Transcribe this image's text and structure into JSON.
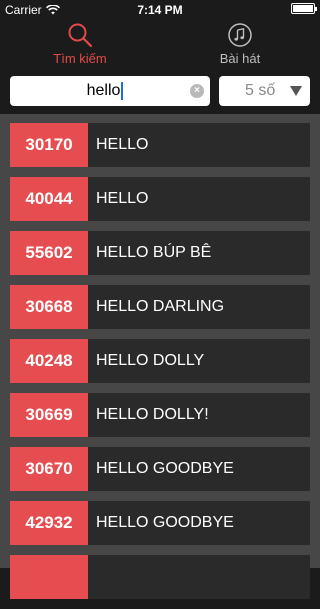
{
  "status": {
    "carrier": "Carrier",
    "time": "7:14 PM"
  },
  "tabs": [
    {
      "label": "Tìm kiếm",
      "icon": "search-icon",
      "active": true
    },
    {
      "label": "Bài hát",
      "icon": "music-note-icon",
      "active": false
    }
  ],
  "search": {
    "value": "hello"
  },
  "filter": {
    "selected": "5 số"
  },
  "results": [
    {
      "code": "30170",
      "title": "HELLO"
    },
    {
      "code": "40044",
      "title": "HELLO"
    },
    {
      "code": "55602",
      "title": "HELLO BÚP BÊ"
    },
    {
      "code": "30668",
      "title": "HELLO DARLING"
    },
    {
      "code": "40248",
      "title": "HELLO DOLLY"
    },
    {
      "code": "30669",
      "title": "HELLO DOLLY!"
    },
    {
      "code": "30670",
      "title": "HELLO GOODBYE"
    },
    {
      "code": "42932",
      "title": "HELLO GOODBYE"
    },
    {
      "code": "",
      "title": ""
    }
  ],
  "colors": {
    "accent": "#e54d50",
    "background": "#1b1b1b",
    "list_bg": "#474747",
    "row_bg": "#2a2a2a"
  }
}
